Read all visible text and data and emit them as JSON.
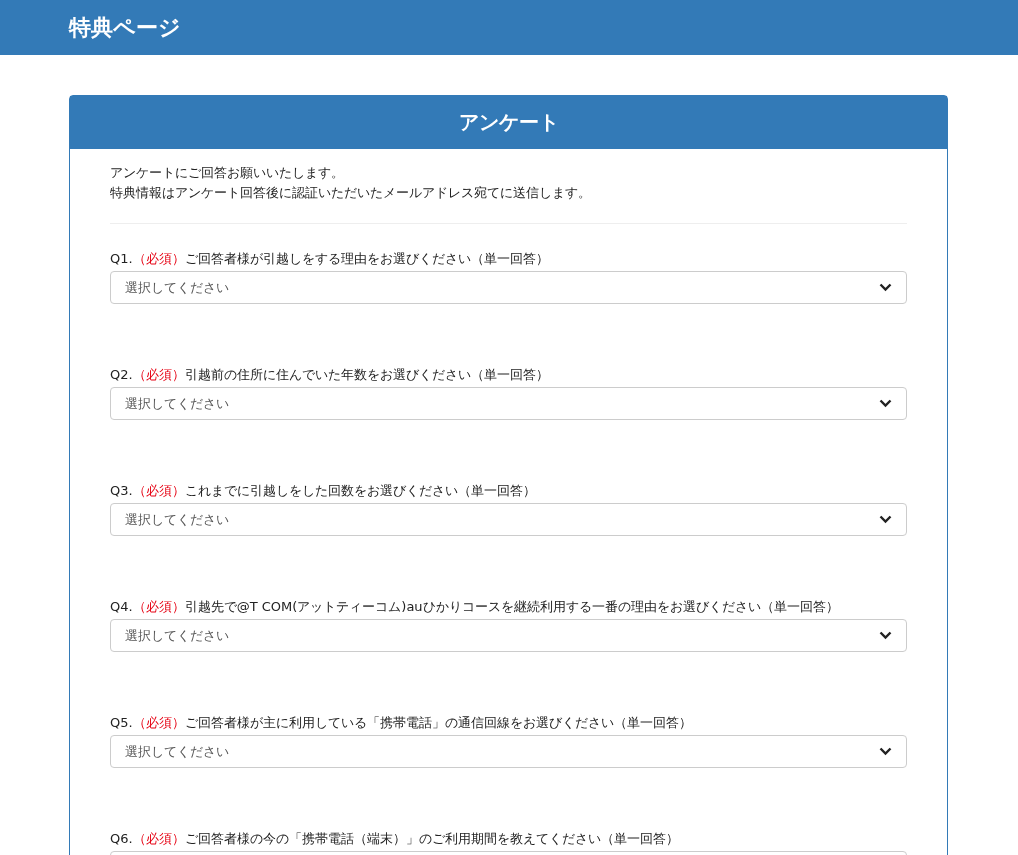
{
  "header": {
    "title": "特典ページ"
  },
  "survey": {
    "title": "アンケート",
    "intro": [
      "アンケートにご回答お願いいたします。",
      "特典情報はアンケート回答後に認証いただいたメールアドレス宛てに送信します。"
    ],
    "questions": [
      {
        "number": "Q1.",
        "required": "（必須）",
        "text": "ご回答者様が引越しをする理由をお選びください（単一回答）",
        "placeholder": "選択してください"
      },
      {
        "number": "Q2.",
        "required": "（必須）",
        "text": "引越前の住所に住んでいた年数をお選びください（単一回答）",
        "placeholder": "選択してください"
      },
      {
        "number": "Q3.",
        "required": "（必須）",
        "text": "これまでに引越しをした回数をお選びください（単一回答）",
        "placeholder": "選択してください"
      },
      {
        "number": "Q4.",
        "required": "（必須）",
        "text": "引越先で@T COM(アットティーコム)auひかりコースを継続利用する一番の理由をお選びください（単一回答）",
        "placeholder": "選択してください"
      },
      {
        "number": "Q5.",
        "required": "（必須）",
        "text": "ご回答者様が主に利用している「携帯電話」の通信回線をお選びください（単一回答）",
        "placeholder": "選択してください"
      },
      {
        "number": "Q6.",
        "required": "（必須）",
        "text": "ご回答者様の今の「携帯電話（端末）」のご利用期間を教えてください（単一回答）"
      }
    ]
  }
}
